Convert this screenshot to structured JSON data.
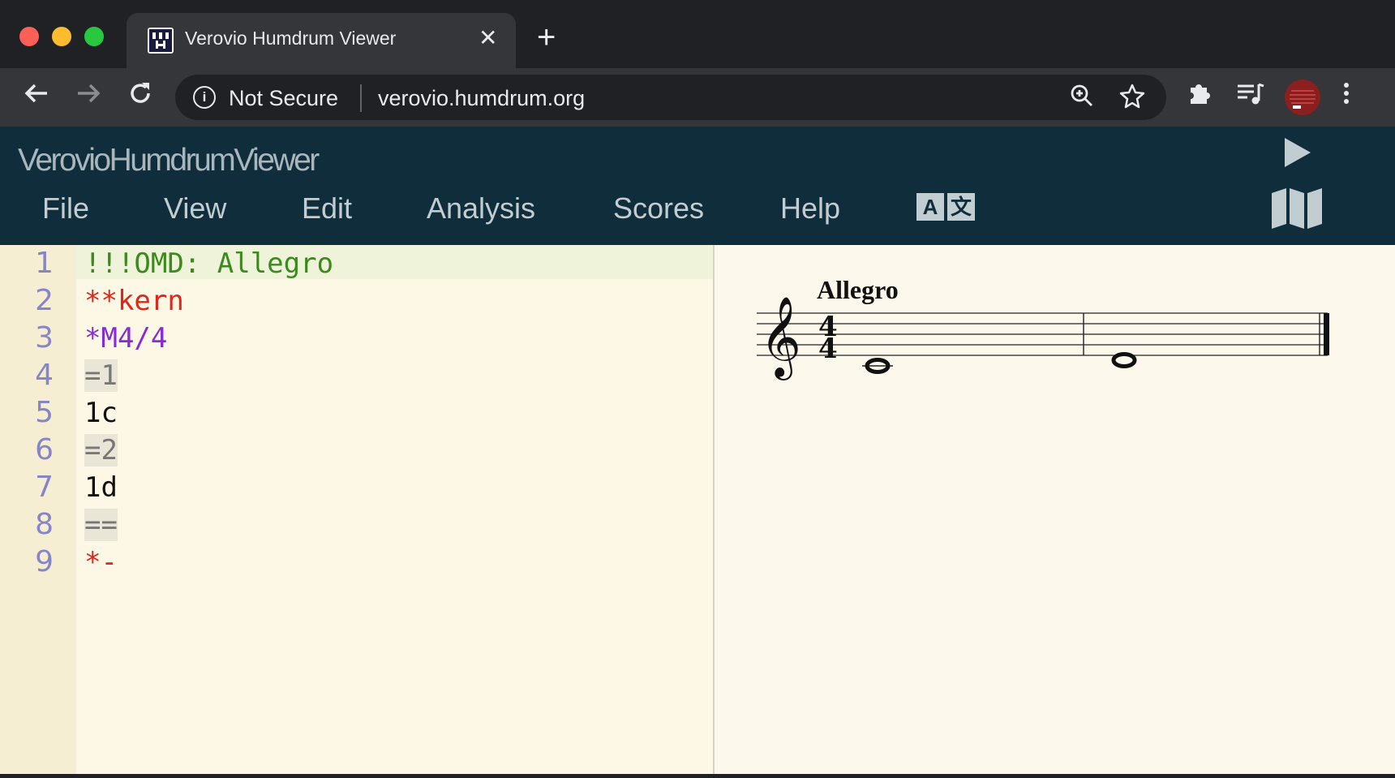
{
  "browser": {
    "tab_title": "Verovio Humdrum Viewer",
    "tab_close": "✕",
    "new_tab": "+",
    "security_label": "Not Secure",
    "url": "verovio.humdrum.org",
    "favicon_text": "VV H"
  },
  "app": {
    "title": "VerovioHumdrumViewer",
    "menu": [
      "File",
      "View",
      "Edit",
      "Analysis",
      "Scores",
      "Help"
    ],
    "lang_glyphs": [
      "A",
      "文"
    ]
  },
  "editor": {
    "lines": [
      {
        "num": "1",
        "text": "!!!OMD: Allegro",
        "color": "#3a8a1c"
      },
      {
        "num": "2",
        "text": "**kern",
        "color": "#e0261b"
      },
      {
        "num": "3",
        "text": "*M4/4",
        "color": "#8a2ad6"
      },
      {
        "num": "4",
        "text": "=1",
        "color": "#777777"
      },
      {
        "num": "5",
        "text": "1c",
        "color": "#111111"
      },
      {
        "num": "6",
        "text": "=2",
        "color": "#777777"
      },
      {
        "num": "7",
        "text": "1d",
        "color": "#111111"
      },
      {
        "num": "8",
        "text": "==",
        "color": "#777777"
      },
      {
        "num": "9",
        "text": "*-",
        "color": "#e0261b"
      }
    ]
  },
  "score": {
    "tempo_text": "Allegro",
    "time_signature": {
      "top": "4",
      "bottom": "4"
    },
    "notes": [
      {
        "pitch": "c",
        "duration": "whole",
        "measure": 1
      },
      {
        "pitch": "d",
        "duration": "whole",
        "measure": 2
      }
    ]
  }
}
